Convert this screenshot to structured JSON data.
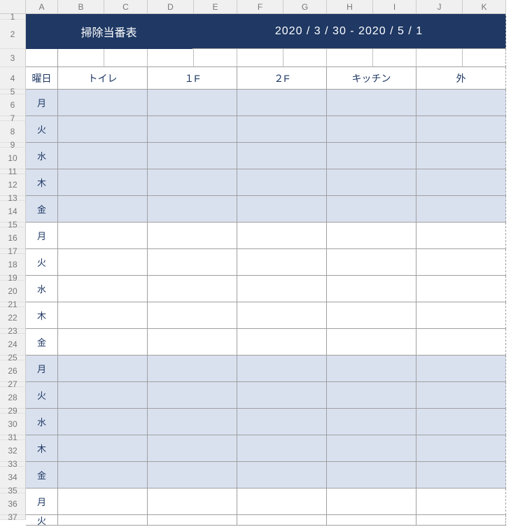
{
  "columns": [
    "A",
    "B",
    "C",
    "D",
    "E",
    "F",
    "G",
    "H",
    "I",
    "J",
    "K"
  ],
  "title": "掃除当番表",
  "date_range": "2020 / 3 / 30 - 2020 / 5 / 1",
  "headers": {
    "day": "曜日",
    "col1": "トイレ",
    "col2": "１F",
    "col3": "２F",
    "col4": "キッチン",
    "col5": "外"
  },
  "days": [
    "月",
    "火",
    "水",
    "木",
    "金",
    "月",
    "火",
    "水",
    "木",
    "金",
    "月",
    "火",
    "水",
    "木",
    "金",
    "月",
    "火"
  ],
  "row_heights": {
    "r1": 8,
    "r2": 42,
    "r3": 26,
    "r4": 32,
    "thin": 7,
    "wide": 31
  }
}
